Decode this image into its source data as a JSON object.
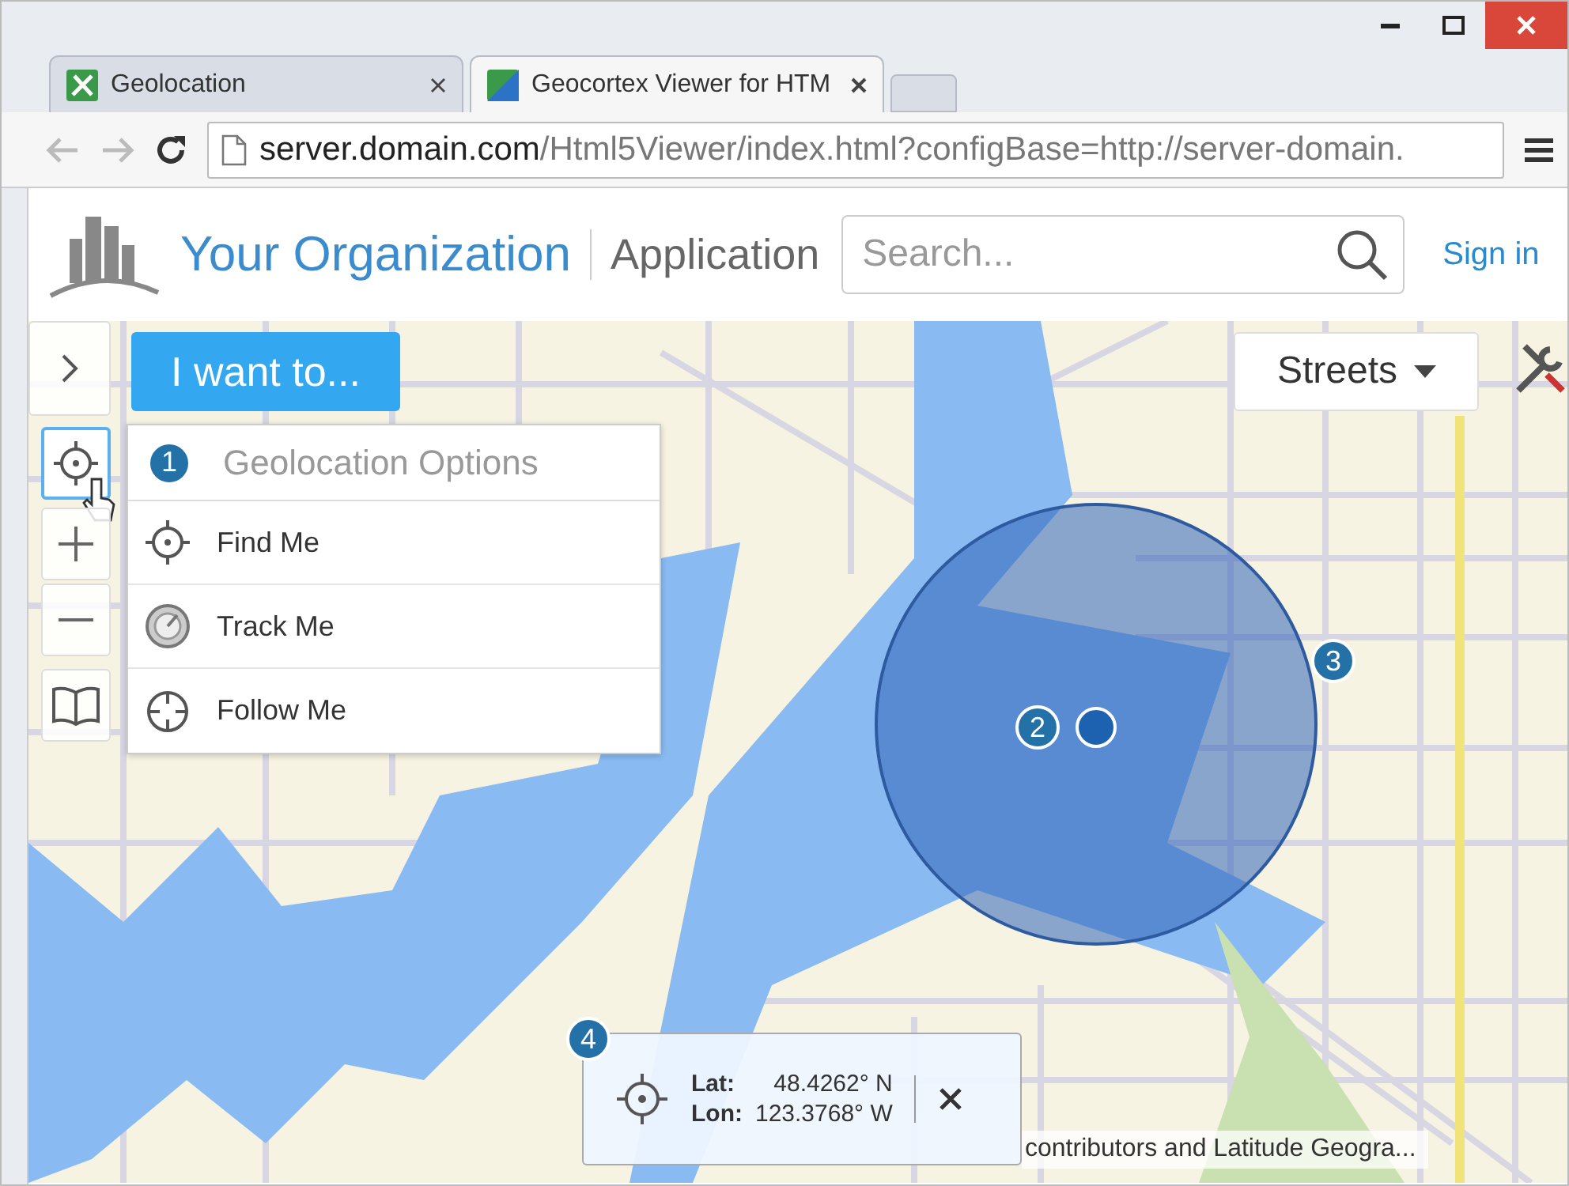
{
  "tabs": [
    {
      "label": "Geolocation",
      "selected": false
    },
    {
      "label": "Geocortex Viewer for HTM",
      "selected": true
    }
  ],
  "address": {
    "host": "server.domain.com",
    "path": "/Html5Viewer/index.html?configBase=http://server-domain."
  },
  "header": {
    "organization": "Your Organization",
    "application": "Application",
    "search": {
      "placeholder": "Search..."
    },
    "sign_in": "Sign in"
  },
  "map": {
    "i_want_to": "I want to...",
    "basemap": "Streets",
    "geolocation_menu": {
      "callout": "1",
      "title": "Geolocation Options",
      "items": [
        {
          "label": "Find Me",
          "kind": "find"
        },
        {
          "label": "Track Me",
          "kind": "track"
        },
        {
          "label": "Follow Me",
          "kind": "follow"
        }
      ]
    },
    "location_callout": "2",
    "accuracy_callout": "3",
    "coordinates": {
      "callout": "4",
      "lat_label": "Lat:",
      "lat": "48.4262° N",
      "lon_label": "Lon:",
      "lon": "123.3768° W"
    },
    "attribution": "contributors and Latitude Geogra..."
  }
}
